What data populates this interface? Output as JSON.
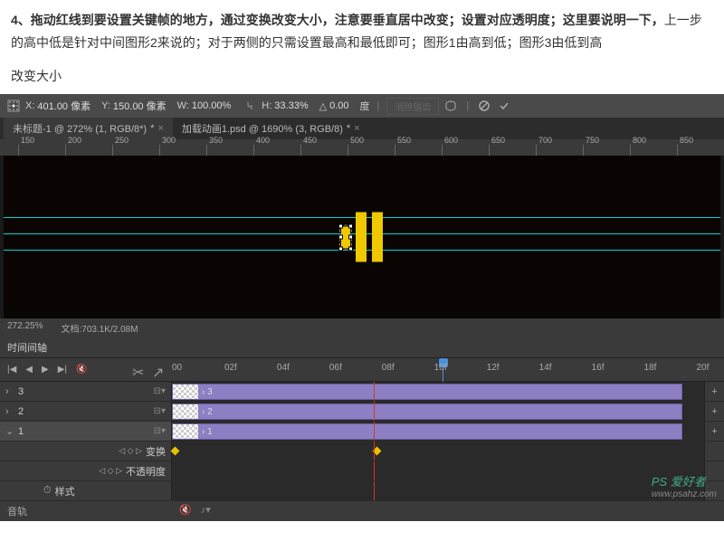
{
  "instructions": {
    "line1_bold": "4、拖动红线到要设置关键帧的地方，通过变换改变大小，注意要垂直居中改变；设置对应透明度；这里要说明一下，",
    "line1_rest": "上一步的高中低是针对中间图形2来说的；对于两侧的只需设置最高和最低即可；图形1由高到低；图形3由低到高"
  },
  "sub_title": "改变大小",
  "toolbar": {
    "x_label": "X:",
    "x_val": "401.00 像素",
    "y_label": "Y:",
    "y_val": "150.00 像素",
    "w_label": "W:",
    "w_val": "100.00%",
    "h_label": "H:",
    "h_val": "33.33%",
    "angle_label": "△",
    "angle_val": "0.00",
    "deg": "度",
    "clear_btn": "消除锯齿"
  },
  "tabs": [
    {
      "label": "未标题-1 @ 272% (1, RGB/8*)",
      "dirty": "*"
    },
    {
      "label": "加载动画1.psd @ 1690% (3, RGB/8)",
      "dirty": "*"
    }
  ],
  "ruler_marks": [
    "150",
    "200",
    "250",
    "300",
    "350",
    "400",
    "450",
    "500",
    "550",
    "600",
    "650",
    "700",
    "750",
    "800",
    "850"
  ],
  "status": {
    "zoom": "272.25%",
    "doc": "文档:703.1K/2.08M"
  },
  "timeline": {
    "title": "时间间轴",
    "frames": [
      "00",
      "02f",
      "04f",
      "06f",
      "08f",
      "10f",
      "12f",
      "14f",
      "16f",
      "18f",
      "20f"
    ],
    "tracks": [
      {
        "name": "3",
        "clip_label": "3"
      },
      {
        "name": "2",
        "clip_label": "2"
      },
      {
        "name": "1",
        "clip_label": "1",
        "expanded": true
      }
    ],
    "props": {
      "transform": "变换",
      "opacity": "不透明度",
      "style": "样式"
    },
    "footer_label": "音轨"
  },
  "watermark": {
    "brand": "PS 爱好者",
    "url": "www.psahz.com"
  }
}
